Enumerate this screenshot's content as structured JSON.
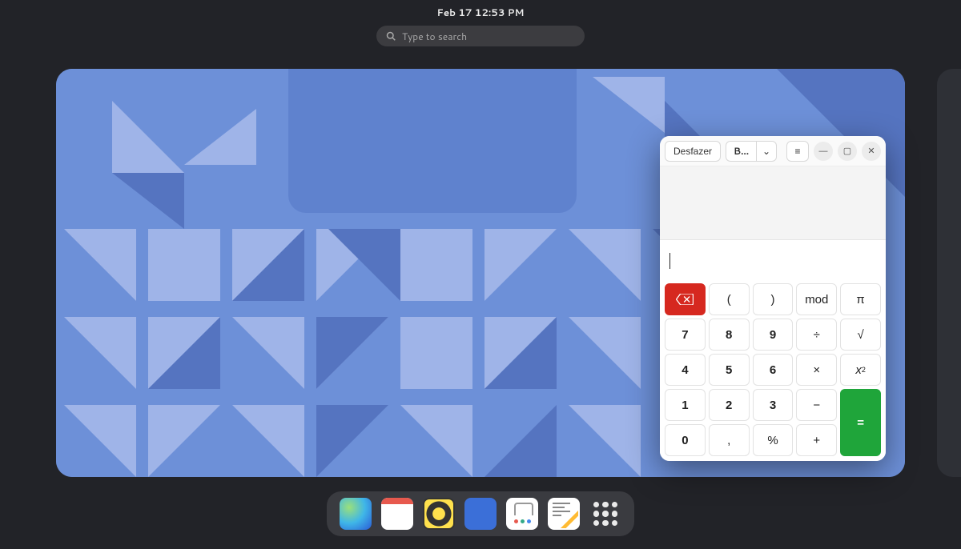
{
  "topbar": {
    "datetime": "Feb 17  12:53 PM"
  },
  "search": {
    "placeholder": "Type to search"
  },
  "calculator": {
    "header": {
      "undo_label": "Desfazer",
      "mode_label": "B…",
      "mode_chevron": "⌄",
      "menu_icon": "≡",
      "minimize_icon": "—",
      "maximize_icon": "▢",
      "close_icon": "✕"
    },
    "entry_value": "",
    "keys": {
      "clear": "⌫",
      "lparen": "(",
      "rparen": ")",
      "mod": "mod",
      "pi": "π",
      "k7": "7",
      "k8": "8",
      "k9": "9",
      "div": "÷",
      "sqrt": "√",
      "k4": "4",
      "k5": "5",
      "k6": "6",
      "mul": "×",
      "sq": "x²",
      "k1": "1",
      "k2": "2",
      "k3": "3",
      "sub": "−",
      "eq": "=",
      "k0": "0",
      "comma": ",",
      "pct": "%",
      "add": "+"
    }
  },
  "dock": {
    "items": [
      {
        "name": "web-browser"
      },
      {
        "name": "calendar"
      },
      {
        "name": "music"
      },
      {
        "name": "todo"
      },
      {
        "name": "software"
      },
      {
        "name": "text-editor"
      },
      {
        "name": "app-grid"
      }
    ]
  }
}
